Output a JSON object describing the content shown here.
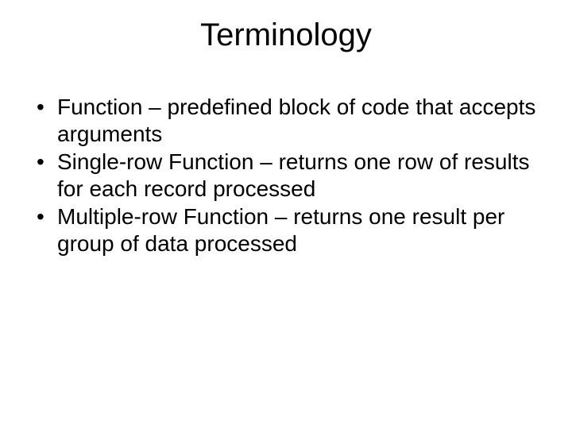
{
  "slide": {
    "title": "Terminology",
    "bullets": [
      "Function – predefined block of code that accepts arguments",
      "Single-row Function – returns one row of results for each record processed",
      "Multiple-row Function – returns one result per group of data processed"
    ]
  }
}
